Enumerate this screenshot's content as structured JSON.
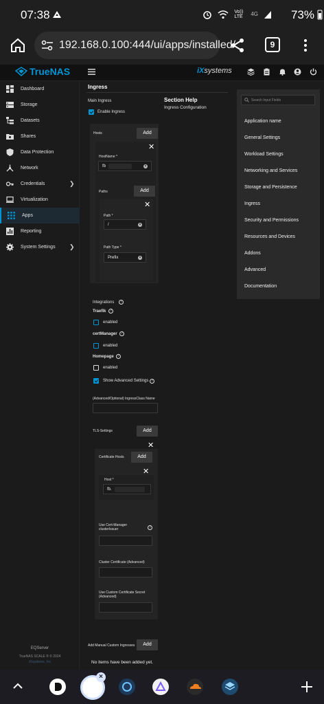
{
  "status_bar": {
    "time": "07:38",
    "network": "Vo)) LTE",
    "signal_type": "4G",
    "battery": "73%"
  },
  "browser": {
    "url": "192.168.0.100:444/ui/apps/installed/",
    "tab_count": "9"
  },
  "header": {
    "logo_text": "TrueNAS",
    "vendor_logo": "systems",
    "vendor_prefix": "iX"
  },
  "sidebar": {
    "items": [
      {
        "label": "Dashboard",
        "icon": "dashboard-icon"
      },
      {
        "label": "Storage",
        "icon": "storage-icon"
      },
      {
        "label": "Datasets",
        "icon": "datasets-icon"
      },
      {
        "label": "Shares",
        "icon": "folder-icon"
      },
      {
        "label": "Data Protection",
        "icon": "shield-icon"
      },
      {
        "label": "Network",
        "icon": "network-icon"
      },
      {
        "label": "Credentials",
        "icon": "key-icon"
      },
      {
        "label": "Virtualization",
        "icon": "laptop-icon"
      },
      {
        "label": "Apps",
        "icon": "apps-icon"
      },
      {
        "label": "Reporting",
        "icon": "chart-icon"
      },
      {
        "label": "System Settings",
        "icon": "gear-icon"
      }
    ],
    "hostname": "EQServer",
    "copyright": "TrueNAS SCALE ® © 2024",
    "company": "iXsystems, Inc"
  },
  "form": {
    "section_title": "Ingress",
    "main_ingress_label": "Main Ingress",
    "enable_ingress_label": "Enable Ingress",
    "hosts_label": "Hosts",
    "add_label": "Add",
    "hostname_label": "HostName *",
    "hostname_value": "fb",
    "paths_label": "Paths",
    "path_label": "Path *",
    "path_value": "/",
    "path_type_label": "Path Type *",
    "path_type_value": "Prefix",
    "integrations_label": "Integrations",
    "traefik_label": "Traefik",
    "traefik_enabled": "enabled",
    "certmanager_label": "certManager",
    "certmanager_enabled": "enabled",
    "homepage_label": "Homepage",
    "homepage_enabled": "enabled",
    "show_advanced_label": "Show Advanced Settings",
    "ingressclass_label": "(Advanced/Optional) IngressClass Name",
    "tls_label": "TLS-Settings",
    "cert_hosts_label": "Certificate Hosts",
    "host_label": "Host *",
    "host_value": "fb.",
    "cert_manager_issuer_label_1": "Use Cert-Manager",
    "cert_manager_issuer_label_2": "clusterIssuer",
    "cluster_cert_label": "Cluster Certificate (Advanced)",
    "custom_secret_label_1": "Use Custom Certificate Secret",
    "custom_secret_label_2": "(Advanced)",
    "manual_ingress_label": "Add Manual Custom Ingresses",
    "no_items": "No items have been added yet."
  },
  "section_help": {
    "title": "Section Help",
    "subtitle": "Ingress Configuration",
    "search_placeholder": "Search Input Fields",
    "items": [
      "Application name",
      "General Settings",
      "Workload Settings",
      "Networking and Services",
      "Storage and Persistence",
      "Ingress",
      "Security and Permissions",
      "Resources and Devices",
      "Addons",
      "Advanced",
      "Documentation"
    ]
  },
  "colors": {
    "accent": "#0095d5",
    "background": "#1b1b1b",
    "panel": "#242424"
  }
}
